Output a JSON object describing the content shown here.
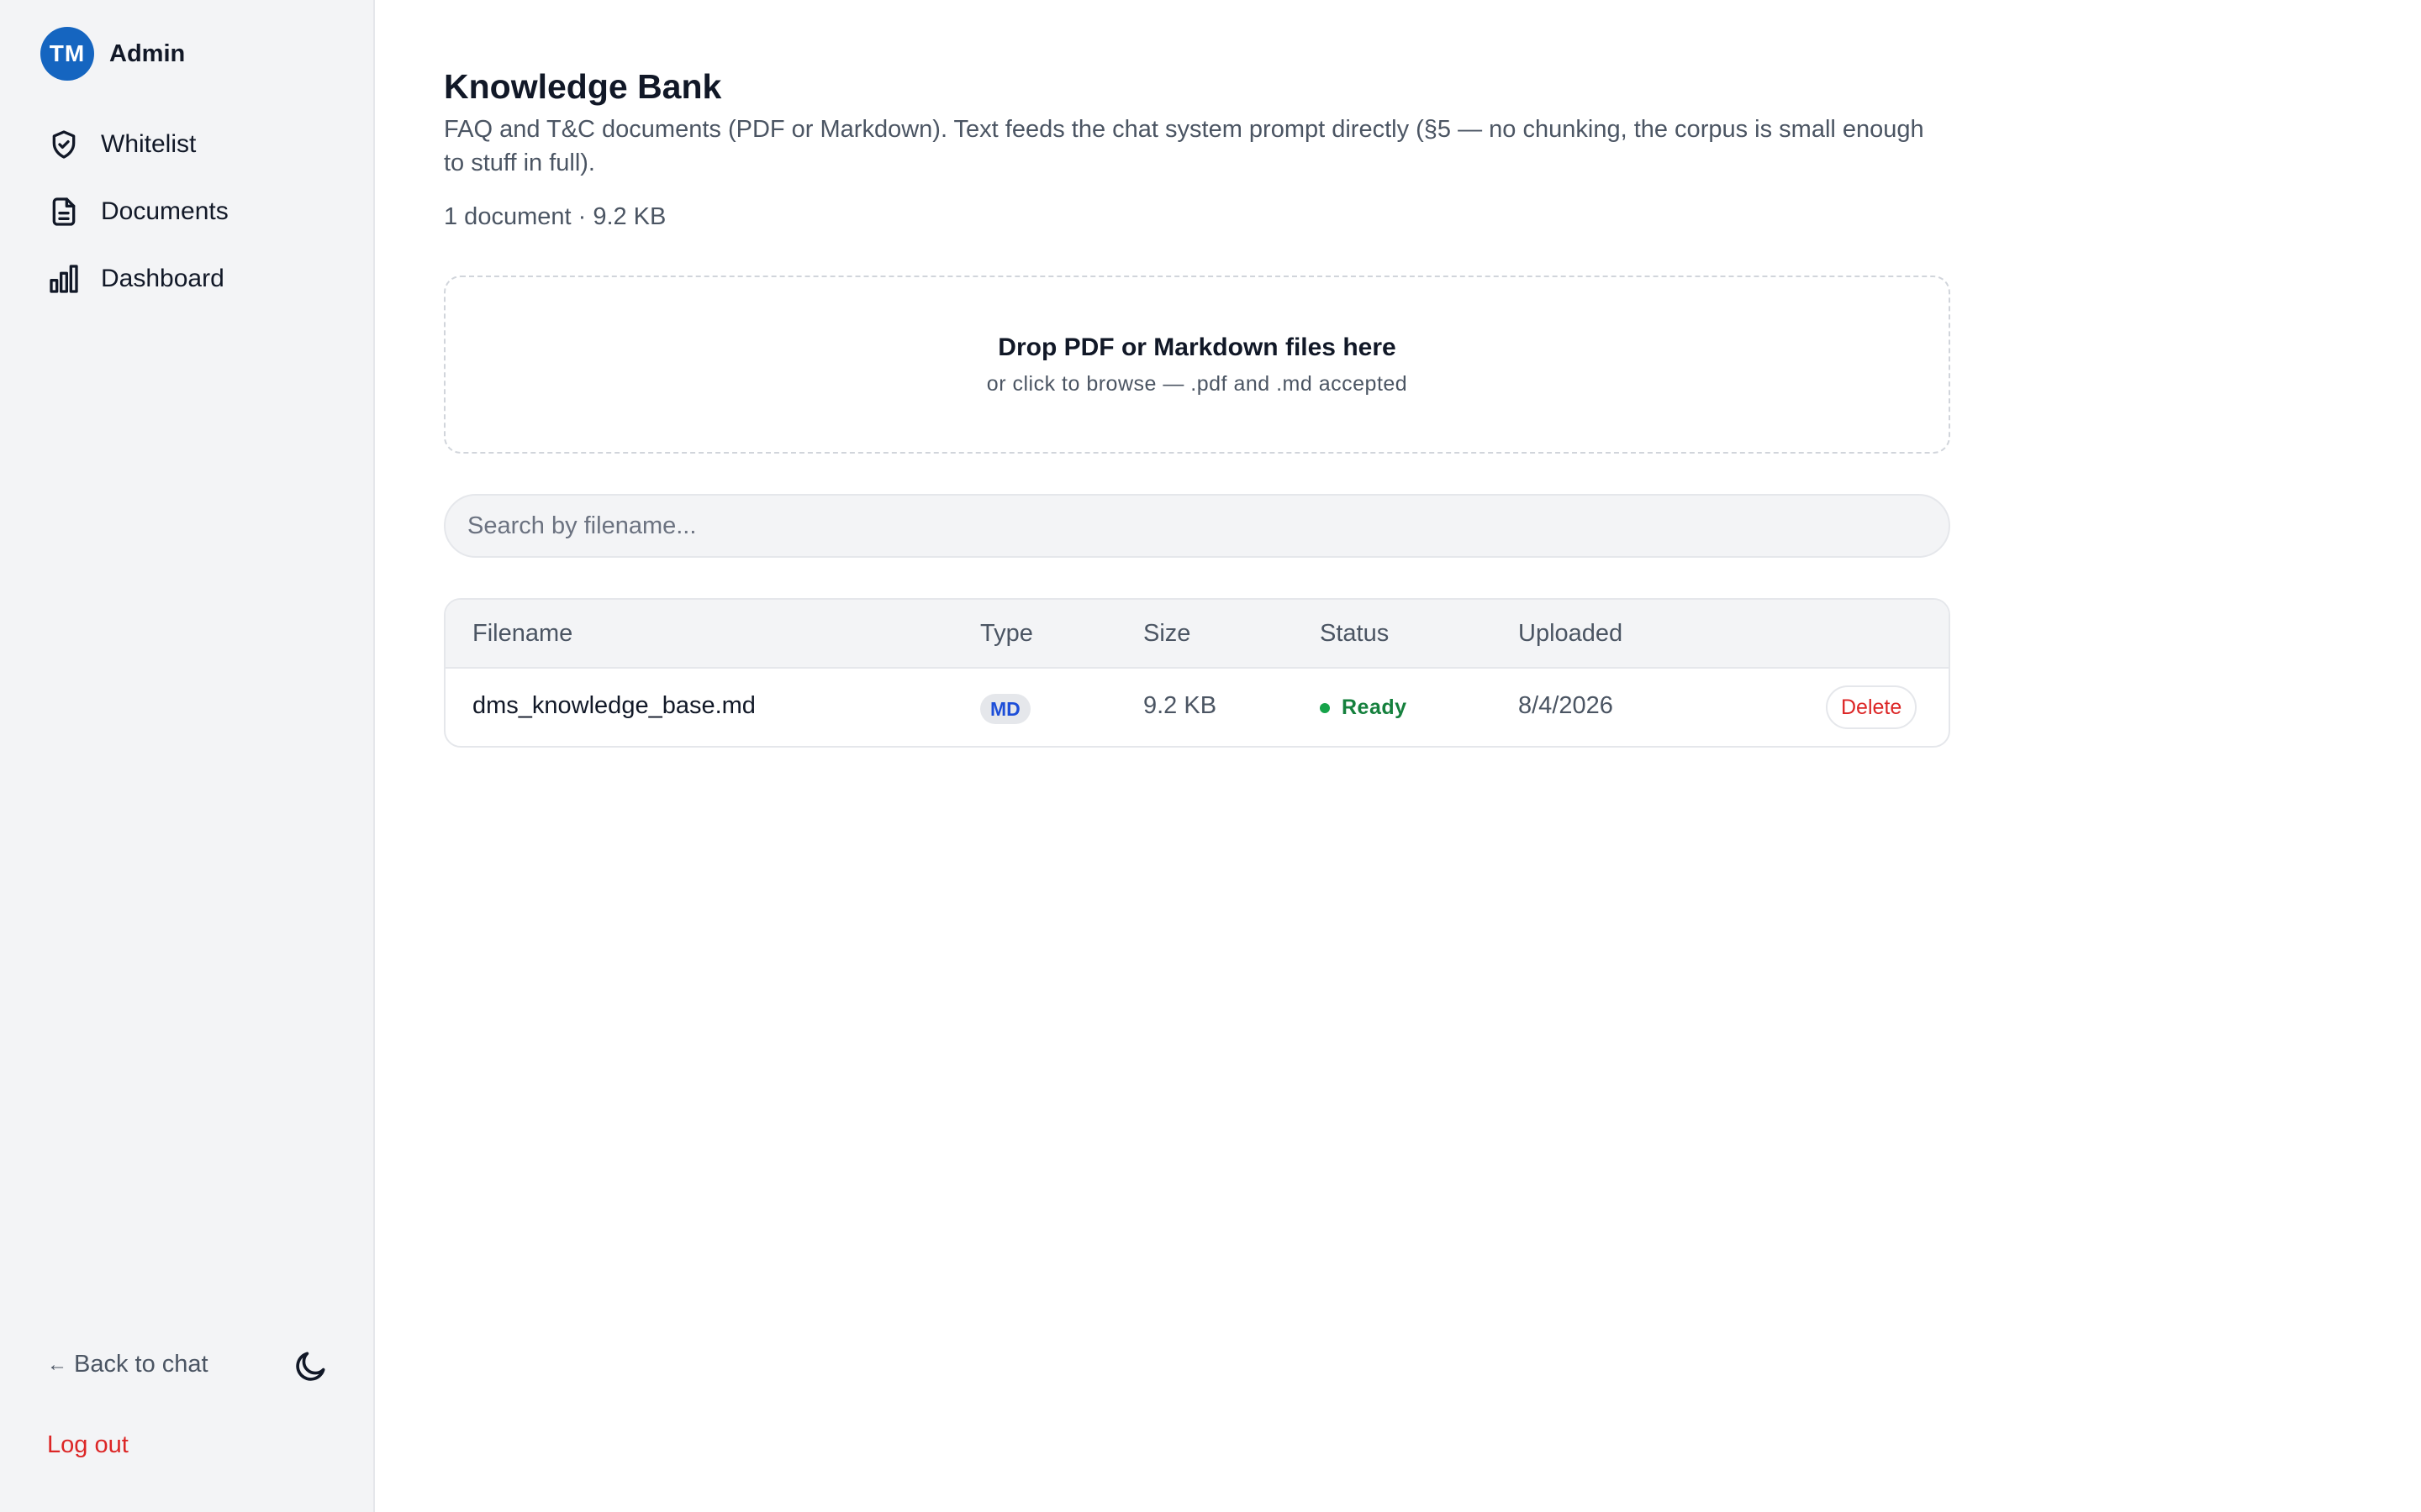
{
  "user": {
    "initials": "TM",
    "name": "Admin"
  },
  "nav": [
    {
      "label": "Whitelist",
      "icon": "shield-check-icon"
    },
    {
      "label": "Documents",
      "icon": "document-icon"
    },
    {
      "label": "Dashboard",
      "icon": "bar-chart-icon"
    }
  ],
  "footer": {
    "back_label": "Back to chat",
    "back_arrow": "←",
    "logout_label": "Log out",
    "theme_icon": "moon-icon"
  },
  "page": {
    "title": "Knowledge Bank",
    "subtitle": "FAQ and T&C documents (PDF or Markdown). Text feeds the chat system prompt directly (§5 — no chunking, the corpus is small enough to stuff in full).",
    "summary": "1 document · 9.2 KB"
  },
  "dropzone": {
    "title": "Drop PDF or Markdown files here",
    "subtitle": "or click to browse — .pdf and .md accepted"
  },
  "search": {
    "placeholder": "Search by filename..."
  },
  "table": {
    "headers": {
      "filename": "Filename",
      "type": "Type",
      "size": "Size",
      "status": "Status",
      "uploaded": "Uploaded"
    },
    "rows": [
      {
        "filename": "dms_knowledge_base.md",
        "type": "MD",
        "size": "9.2 KB",
        "status": "Ready",
        "uploaded": "8/4/2026",
        "action": "Delete"
      }
    ]
  },
  "colors": {
    "accent": "#1565c0",
    "danger": "#dc2626",
    "success": "#15803d"
  }
}
